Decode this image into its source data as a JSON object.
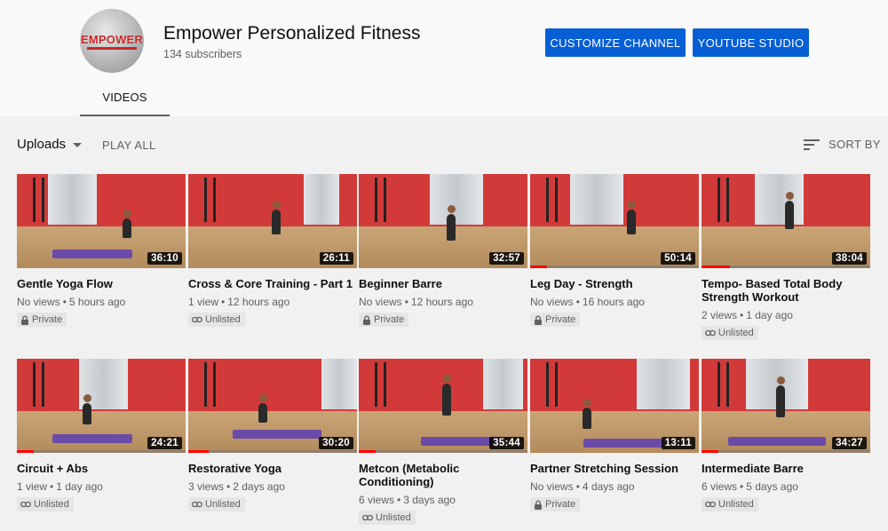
{
  "channel": {
    "avatar_logo_text": "EMPOWER",
    "name": "Empower Personalized Fitness",
    "subscribers": "134 subscribers",
    "customize_label": "CUSTOMIZE CHANNEL",
    "studio_label": "YOUTUBE STUDIO",
    "brand_color": "#065fd4"
  },
  "tabs": [
    {
      "label": "VIDEOS",
      "selected": true
    }
  ],
  "toolbar": {
    "uploads_label": "Uploads",
    "play_all_label": "PLAY ALL",
    "sort_label": "SORT BY"
  },
  "videos": [
    {
      "title": "Gentle Yoga Flow",
      "views": "No views",
      "age": "5 hours ago",
      "duration": "36:10",
      "visibility": "Private",
      "visibility_icon": "lock-icon",
      "watched_fraction": 0
    },
    {
      "title": "Cross & Core Training - Part 1",
      "views": "1 view",
      "age": "12 hours ago",
      "duration": "26:11",
      "visibility": "Unlisted",
      "visibility_icon": "link-icon",
      "watched_fraction": 0
    },
    {
      "title": "Beginner Barre",
      "views": "No views",
      "age": "12 hours ago",
      "duration": "32:57",
      "visibility": "Private",
      "visibility_icon": "lock-icon",
      "watched_fraction": 0
    },
    {
      "title": "Leg Day - Strength",
      "views": "No views",
      "age": "16 hours ago",
      "duration": "50:14",
      "visibility": "Private",
      "visibility_icon": "lock-icon",
      "watched_fraction": 0.1
    },
    {
      "title": "Tempo- Based Total Body Strength Workout",
      "views": "2 views",
      "age": "1 day ago",
      "duration": "38:04",
      "visibility": "Unlisted",
      "visibility_icon": "link-icon",
      "watched_fraction": 0.17
    },
    {
      "title": "Circuit + Abs",
      "views": "1 view",
      "age": "1 day ago",
      "duration": "24:21",
      "visibility": "Unlisted",
      "visibility_icon": "link-icon",
      "watched_fraction": 0.1
    },
    {
      "title": "Restorative Yoga",
      "views": "3 views",
      "age": "2 days ago",
      "duration": "30:20",
      "visibility": "Unlisted",
      "visibility_icon": "link-icon",
      "watched_fraction": 0.12
    },
    {
      "title": "Metcon (Metabolic Conditioning)",
      "views": "6 views",
      "age": "3 days ago",
      "duration": "35:44",
      "visibility": "Unlisted",
      "visibility_icon": "link-icon",
      "watched_fraction": 0.1
    },
    {
      "title": "Partner Stretching Session",
      "views": "No views",
      "age": "4 days ago",
      "duration": "13:11",
      "visibility": "Private",
      "visibility_icon": "lock-icon",
      "watched_fraction": 0
    },
    {
      "title": "Intermediate Barre",
      "views": "6 views",
      "age": "5 days ago",
      "duration": "34:27",
      "visibility": "Unlisted",
      "visibility_icon": "link-icon",
      "watched_fraction": 0.1
    }
  ]
}
